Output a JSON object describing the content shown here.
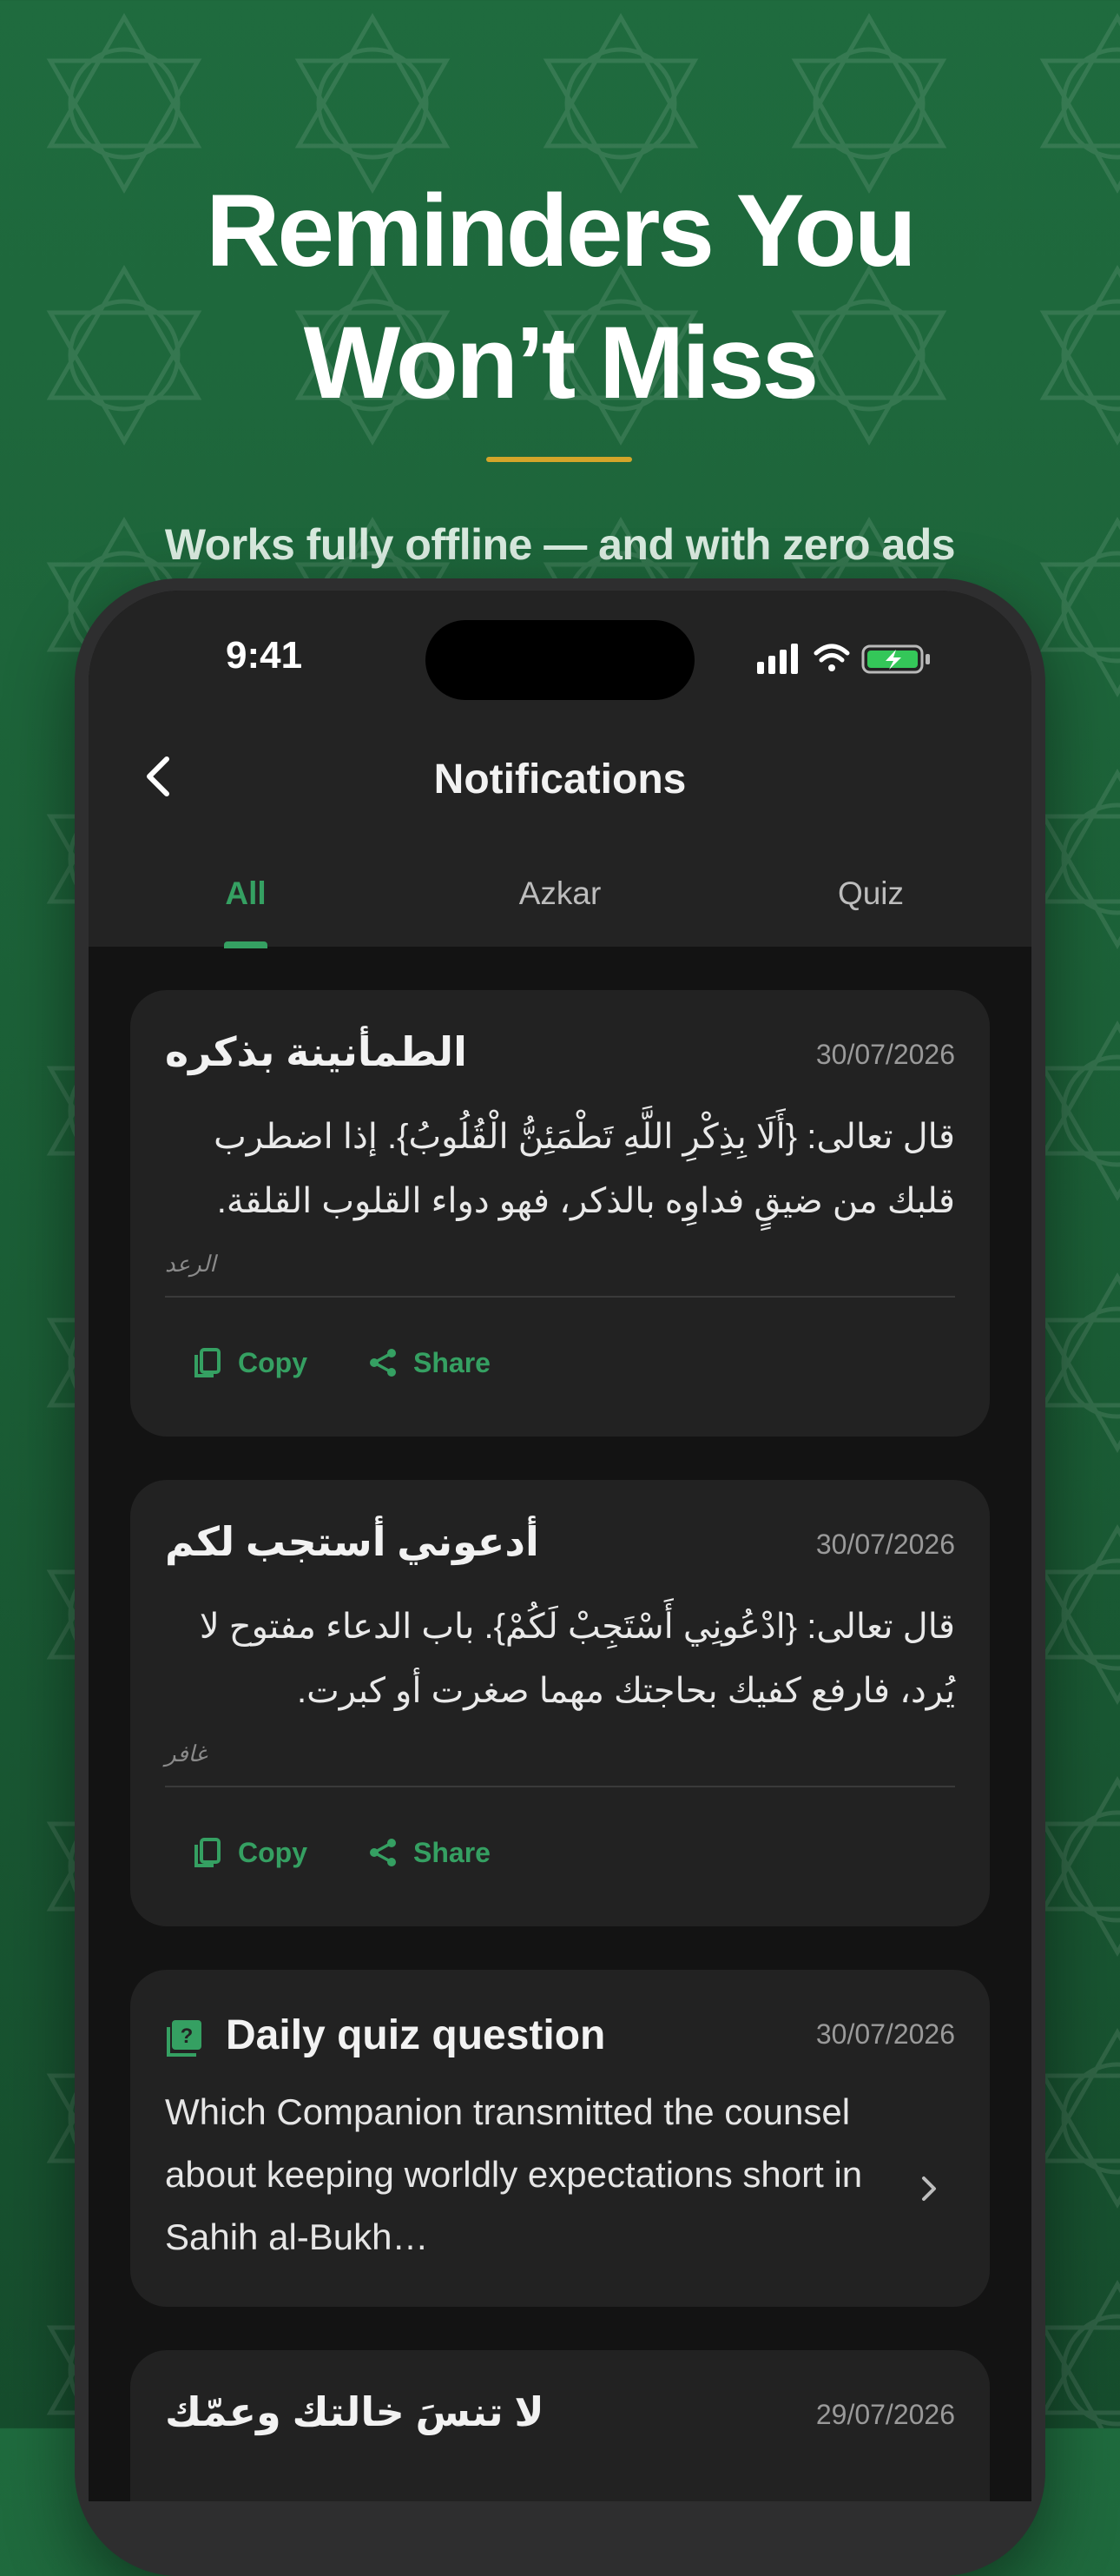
{
  "hero": {
    "headline_line1": "Reminders You",
    "headline_line2": "Won’t Miss",
    "subline": "Works fully offline — and with zero ads",
    "accent_color": "#d4a52a"
  },
  "status_bar": {
    "time": "9:41"
  },
  "header": {
    "title": "Notifications",
    "back_icon": "chevron-left-icon"
  },
  "tabs": [
    {
      "label": "All",
      "active": true
    },
    {
      "label": "Azkar",
      "active": false
    },
    {
      "label": "Quiz",
      "active": false
    }
  ],
  "cards": [
    {
      "title": "الطمأنينة بذكره",
      "date": "30/07/2026",
      "body": "قال تعالى: {أَلَا بِذِكْرِ اللَّهِ تَطْمَئِنُّ الْقُلُوبُ}. إذا اضطرب قلبك من ضيقٍ فداوِه بالذكر، فهو دواء القلوب القلقة.",
      "tag": "الرعد",
      "copy_label": "Copy",
      "share_label": "Share"
    },
    {
      "title": "أدعوني أستجب لكم",
      "date": "30/07/2026",
      "body": "قال تعالى: {ادْعُونِي أَسْتَجِبْ لَكُمْ}. باب الدعاء مفتوح لا يُرد، فارفع كفيك بحاجتك مهما صغرت أو كبرت.",
      "tag": "غافر",
      "copy_label": "Copy",
      "share_label": "Share"
    }
  ],
  "quiz_card": {
    "title": "Daily quiz question",
    "date": "30/07/2026",
    "body": "Which Companion transmitted the counsel about keeping worldly expectations short in Sahih al-Bukh…"
  },
  "partial_card": {
    "title": "لا تنسَ خالتك وعمّك",
    "date": "29/07/2026"
  },
  "colors": {
    "accent_green": "#35a062",
    "card_bg": "#222222",
    "screen_bg": "#131313"
  }
}
